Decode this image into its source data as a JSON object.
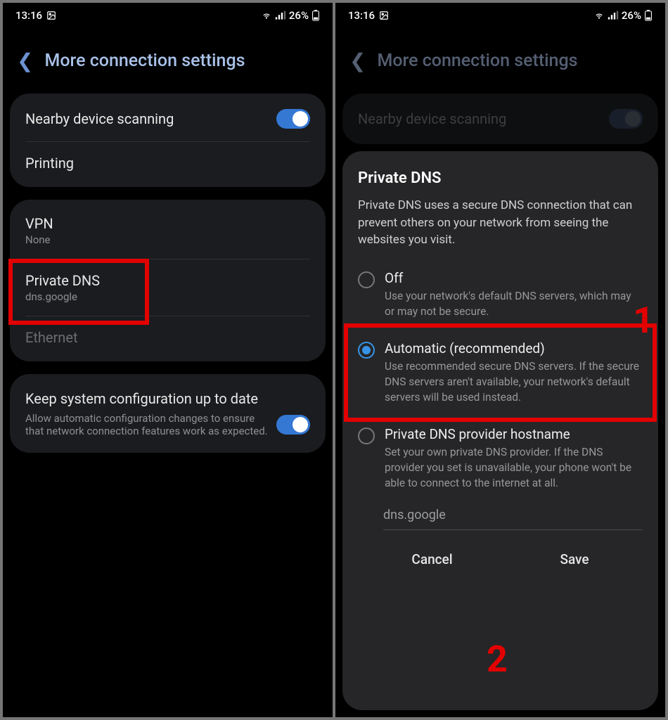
{
  "status": {
    "time": "13:16",
    "battery": "26%"
  },
  "header": {
    "title": "More connection settings"
  },
  "left": {
    "scanning": "Nearby device scanning",
    "printing": "Printing",
    "vpn": {
      "title": "VPN",
      "sub": "None"
    },
    "pdns": {
      "title": "Private DNS",
      "sub": "dns.google"
    },
    "ethernet": "Ethernet",
    "keep": {
      "title": "Keep system configuration up to date",
      "sub": "Allow automatic configuration changes to ensure that network connection features work as expected."
    }
  },
  "dialog": {
    "title": "Private DNS",
    "desc": "Private DNS uses a secure DNS connection that can prevent others on your network from seeing the websites you visit.",
    "off": {
      "title": "Off",
      "desc": "Use your network's default DNS servers, which may or may not be secure."
    },
    "auto": {
      "title": "Automatic (recommended)",
      "desc": "Use recommended secure DNS servers. If the secure DNS servers aren't available, your network's default servers will be used instead."
    },
    "host": {
      "title": "Private DNS provider hostname",
      "desc": "Set your own private DNS provider. If the DNS provider you set is unavailable, your phone won't be able to connect to the internet at all."
    },
    "input": "dns.google",
    "cancel": "Cancel",
    "save": "Save"
  },
  "annotations": {
    "one": "1",
    "two": "2"
  }
}
